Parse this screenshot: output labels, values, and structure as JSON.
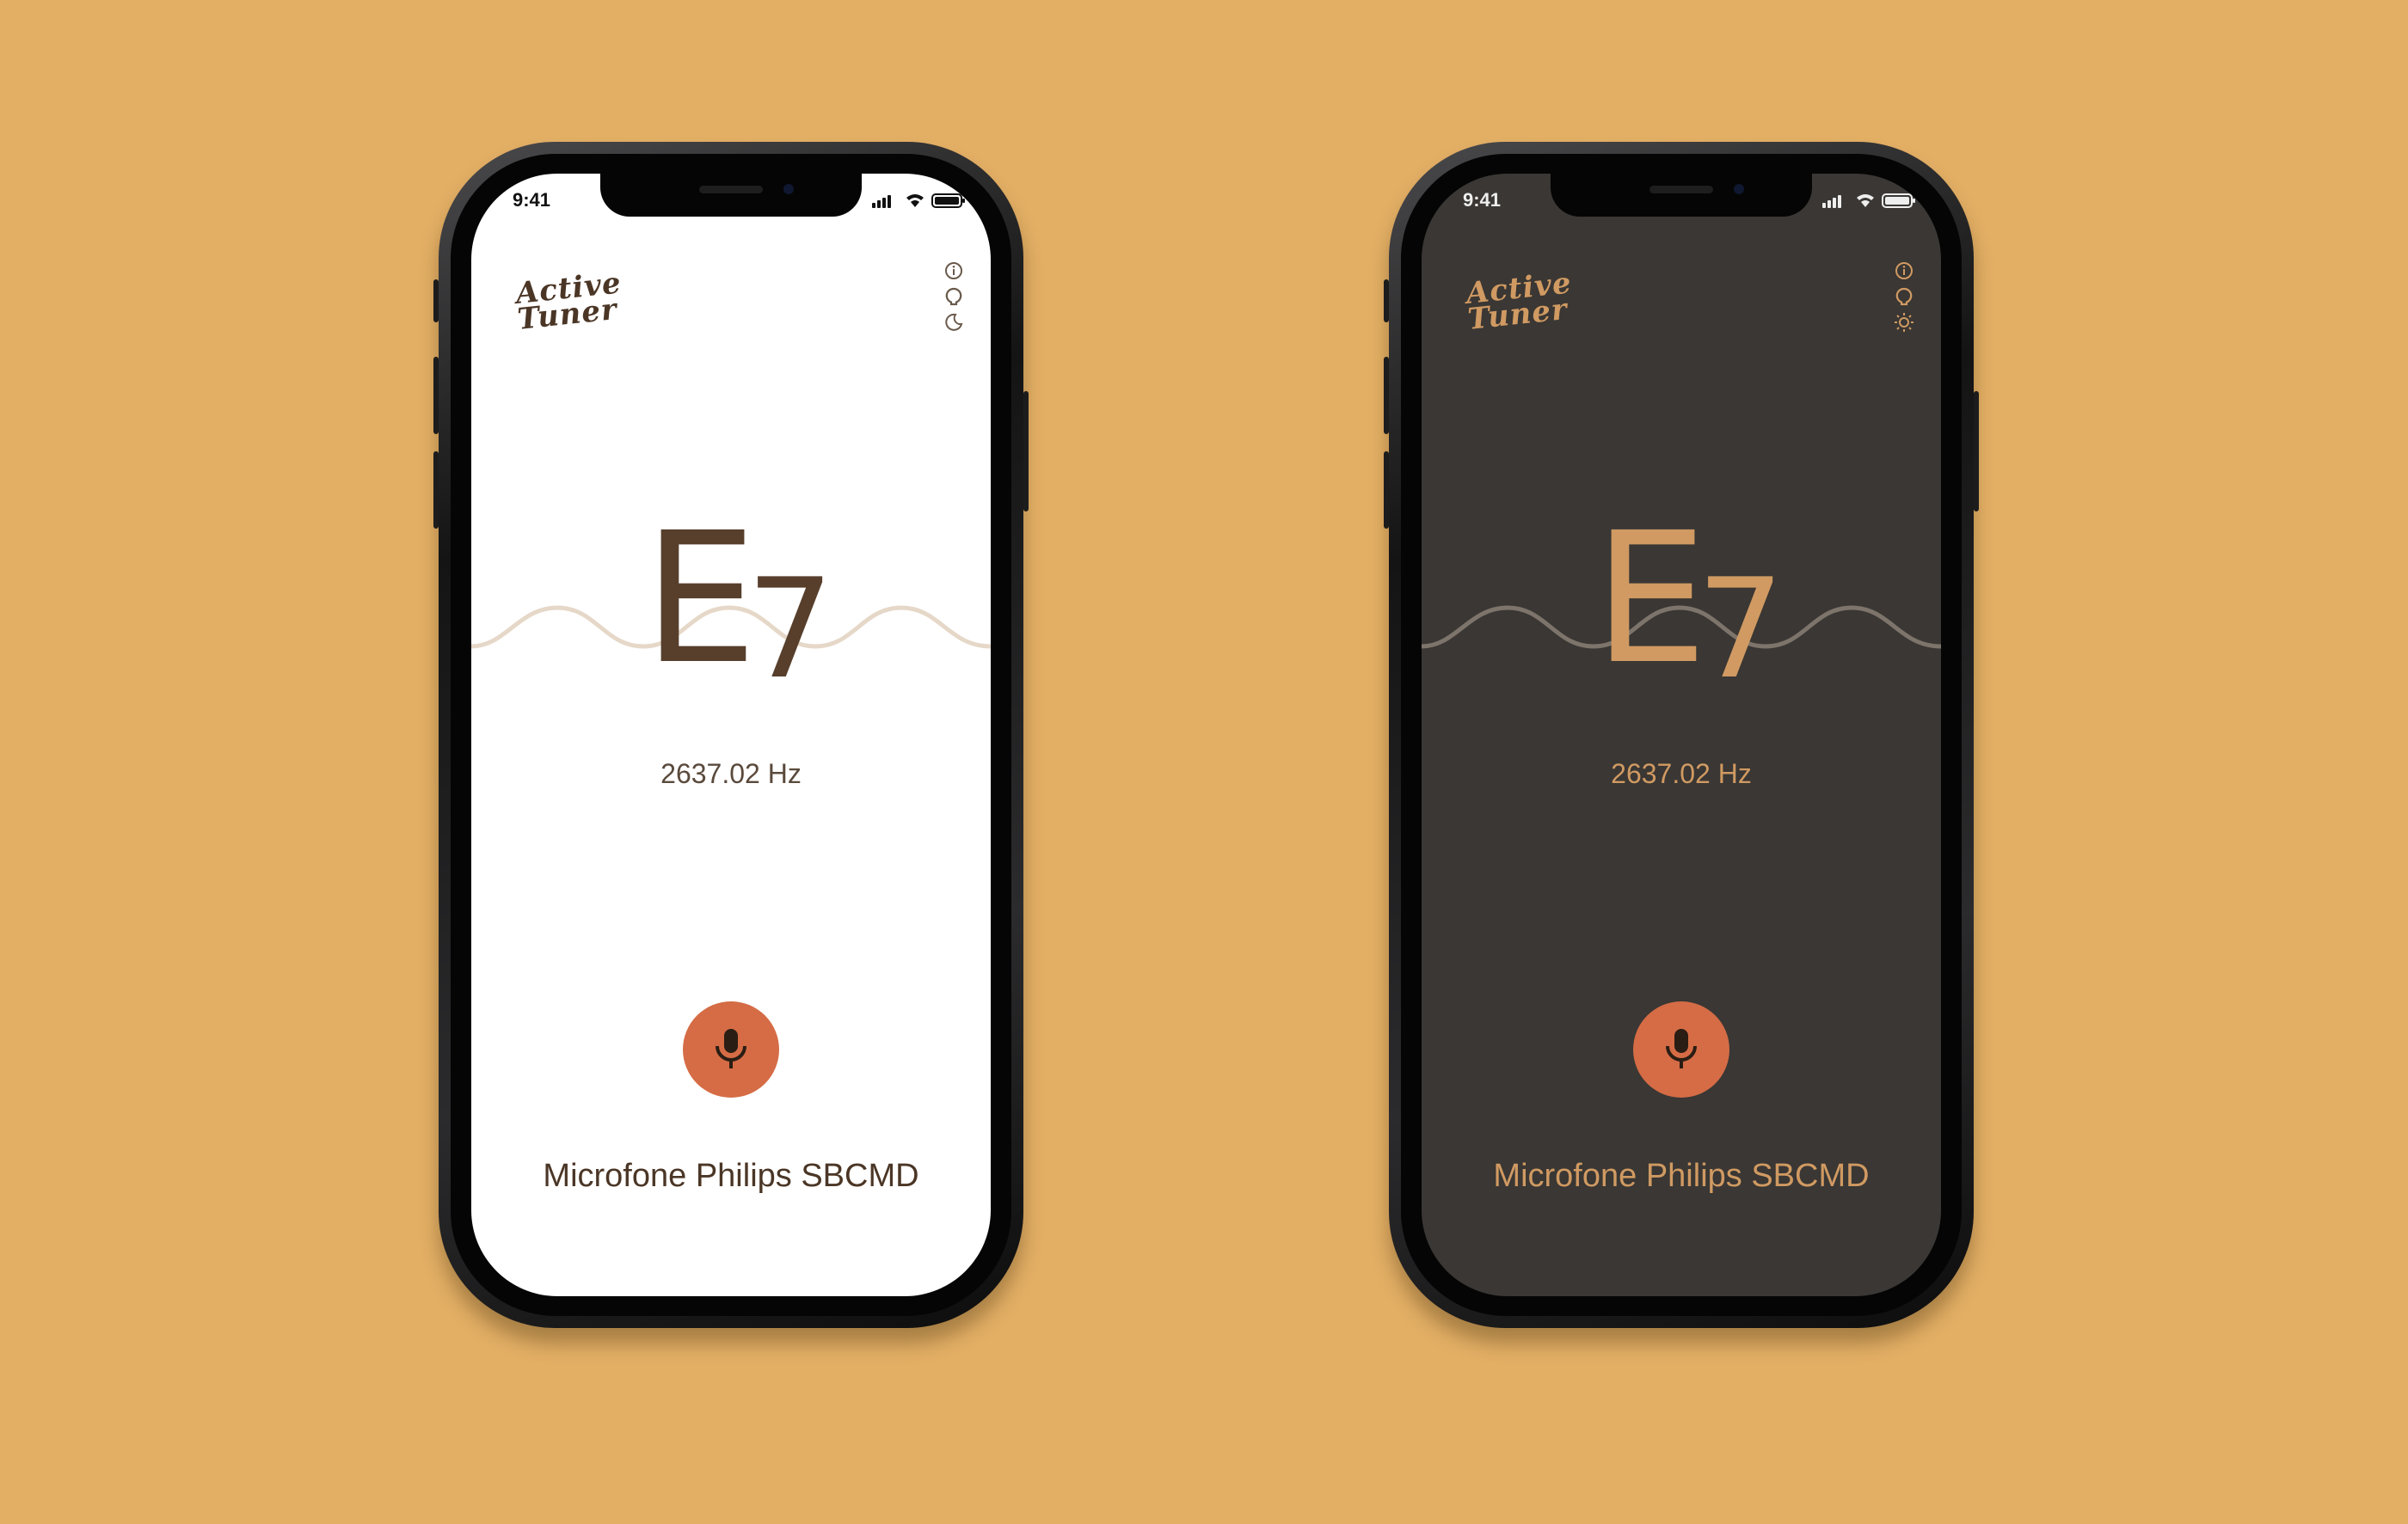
{
  "background_color": "#E3AF65",
  "accent_color": "#D56C45",
  "phones": [
    {
      "theme": "light",
      "status_time": "9:41",
      "logo_line1": "Active",
      "logo_line2": "Tuner",
      "icons": [
        "info-icon",
        "github-icon",
        "moon-icon"
      ],
      "note": "E",
      "octave": "7",
      "frequency": "2637.02 Hz",
      "device_name": "Microfone Philips SBCMD",
      "screen_color": "#ffffff",
      "text_color": "#4b3626"
    },
    {
      "theme": "dark",
      "status_time": "9:41",
      "logo_line1": "Active",
      "logo_line2": "Tuner",
      "icons": [
        "info-icon",
        "github-icon",
        "sun-icon"
      ],
      "note": "E",
      "octave": "7",
      "frequency": "2637.02 Hz",
      "device_name": "Microfone Philips SBCMD",
      "screen_color": "#3a3734",
      "text_color": "#d09a62"
    }
  ]
}
